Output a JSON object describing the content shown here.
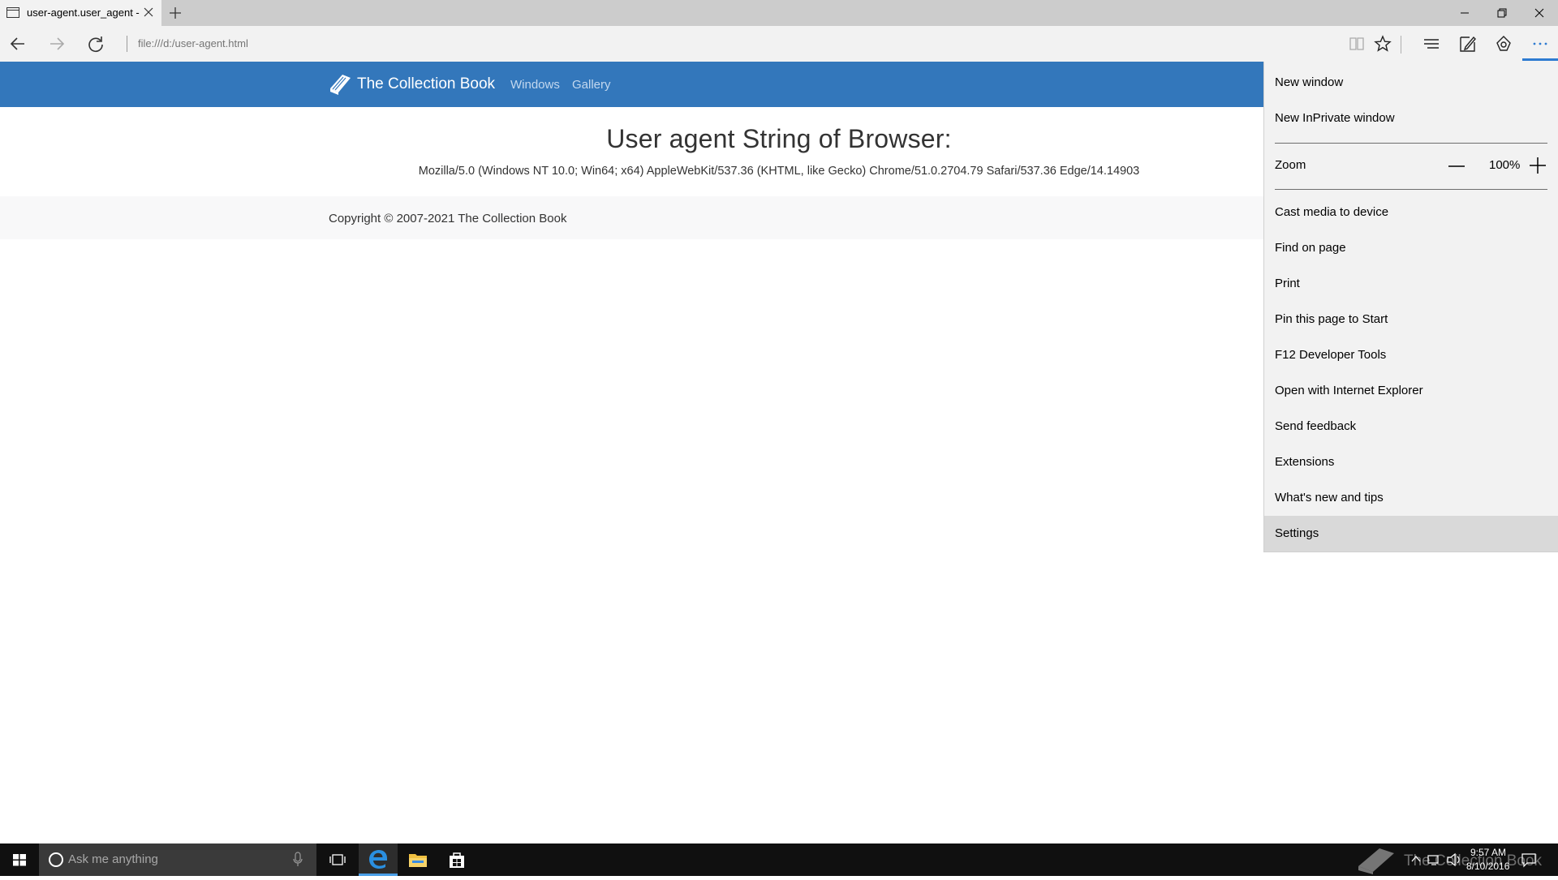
{
  "browser": {
    "tab": {
      "title": "user-agent.user_agent -",
      "close_icon": "close-icon",
      "page_icon": "page-icon"
    },
    "new_tab_icon": "plus-icon",
    "window_controls": [
      "minimize-icon",
      "restore-icon",
      "close-icon"
    ],
    "address": "file:///d:/user-agent.html",
    "toolbar_icons": [
      "reading-view-icon",
      "favorite-star-icon",
      "hub-icon",
      "web-note-icon",
      "share-icon",
      "more-icon"
    ],
    "accent": "#2e7bd1"
  },
  "site": {
    "brand": "The Collection Book",
    "nav": {
      "windows": "Windows",
      "gallery": "Gallery"
    },
    "heading": "User agent String of Browser:",
    "ua_string": "Mozilla/5.0 (Windows NT 10.0; Win64; x64) AppleWebKit/537.36 (KHTML, like Gecko) Chrome/51.0.2704.79 Safari/537.36 Edge/14.14903",
    "copyright": "Copyright © 2007-2021 The Collection Book",
    "nav_color": "#3377bb"
  },
  "menu": {
    "new_window": "New window",
    "new_inprivate": "New InPrivate window",
    "zoom_label": "Zoom",
    "zoom_value": "100%",
    "cast": "Cast media to device",
    "find": "Find on page",
    "print": "Print",
    "pin": "Pin this page to Start",
    "devtools": "F12 Developer Tools",
    "open_ie": "Open with Internet Explorer",
    "feedback": "Send feedback",
    "extensions": "Extensions",
    "whats_new": "What's new and tips",
    "settings": "Settings",
    "hovered_item": "Settings"
  },
  "taskbar": {
    "search_placeholder": "Ask me anything",
    "apps": [
      "task-view-icon",
      "edge-icon",
      "file-explorer-icon",
      "store-icon"
    ],
    "watermark": "The Collection Book",
    "time": "9:57 AM",
    "date": "8/10/2016"
  }
}
